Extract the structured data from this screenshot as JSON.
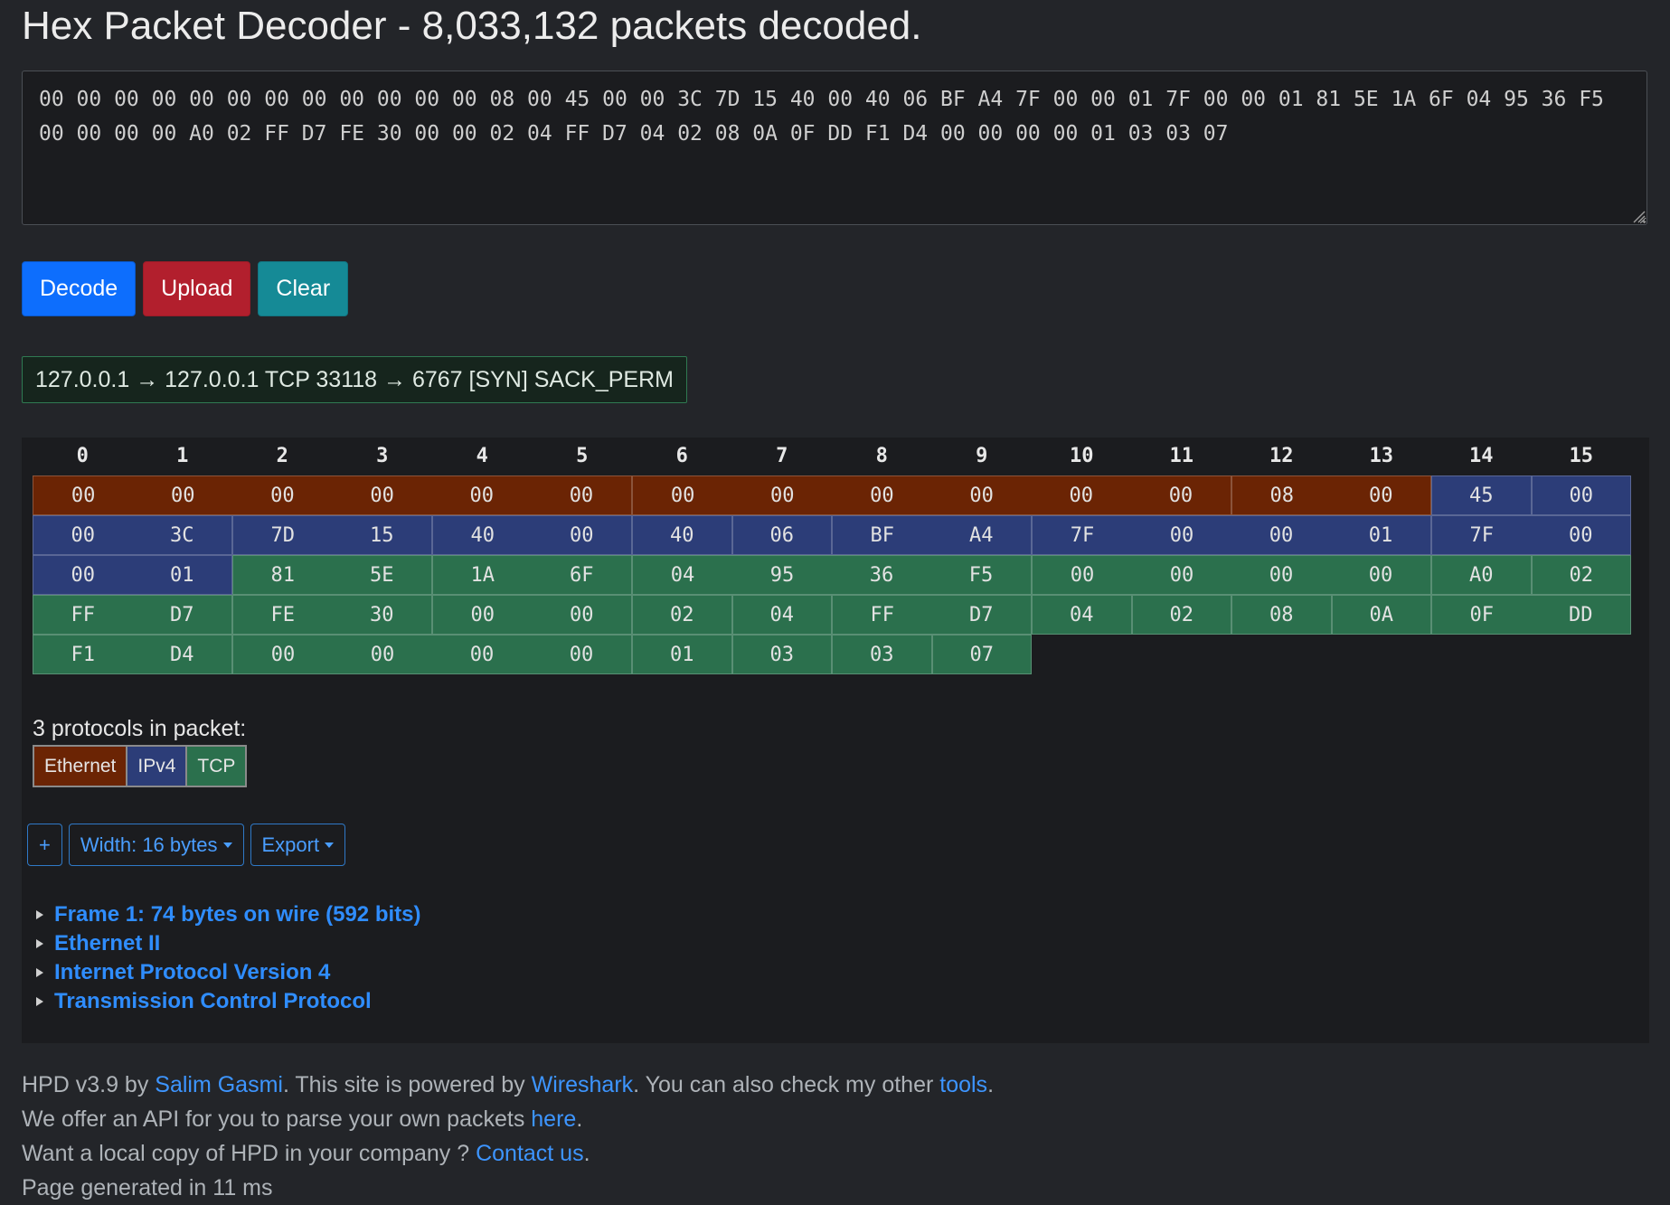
{
  "page": {
    "title": "Hex Packet Decoder - 8,033,132 packets decoded."
  },
  "input": {
    "hex": "00 00 00 00 00 00 00 00 00 00 00 00 08 00 45 00 00 3C 7D 15 40 00 40 06 BF A4 7F 00 00 01 7F 00 00 01 81 5E 1A 6F 04 95 36 F5 00 00 00 00 A0 02 FF D7 FE 30 00 00 02 04 FF D7 04 02 08 0A 0F DD F1 D4 00 00 00 00 01 03 03 07"
  },
  "buttons": {
    "decode": "Decode",
    "upload": "Upload",
    "clear": "Clear"
  },
  "summary": "127.0.0.1 → 127.0.0.1 TCP 33118 → 6767 [SYN] SACK_PERM",
  "hexview": {
    "columns": [
      "0",
      "1",
      "2",
      "3",
      "4",
      "5",
      "6",
      "7",
      "8",
      "9",
      "10",
      "11",
      "12",
      "13",
      "14",
      "15"
    ],
    "rows": [
      [
        {
          "group": [
            {
              "b": "00",
              "p": "eth"
            },
            {
              "b": "00",
              "p": "eth"
            },
            {
              "b": "00",
              "p": "eth"
            },
            {
              "b": "00",
              "p": "eth"
            },
            {
              "b": "00",
              "p": "eth"
            },
            {
              "b": "00",
              "p": "eth"
            }
          ]
        },
        {
          "group": [
            {
              "b": "00",
              "p": "eth"
            },
            {
              "b": "00",
              "p": "eth"
            },
            {
              "b": "00",
              "p": "eth"
            },
            {
              "b": "00",
              "p": "eth"
            },
            {
              "b": "00",
              "p": "eth"
            },
            {
              "b": "00",
              "p": "eth"
            }
          ]
        },
        {
          "group": [
            {
              "b": "08",
              "p": "eth"
            },
            {
              "b": "00",
              "p": "eth"
            }
          ]
        },
        {
          "group": [
            {
              "b": "45",
              "p": "ip"
            }
          ]
        },
        {
          "group": [
            {
              "b": "00",
              "p": "ip"
            }
          ]
        }
      ],
      [
        {
          "group": [
            {
              "b": "00",
              "p": "ip"
            },
            {
              "b": "3C",
              "p": "ip"
            }
          ]
        },
        {
          "group": [
            {
              "b": "7D",
              "p": "ip"
            },
            {
              "b": "15",
              "p": "ip"
            }
          ]
        },
        {
          "group": [
            {
              "b": "40",
              "p": "ip"
            },
            {
              "b": "00",
              "p": "ip"
            }
          ]
        },
        {
          "group": [
            {
              "b": "40",
              "p": "ip"
            }
          ]
        },
        {
          "group": [
            {
              "b": "06",
              "p": "ip"
            }
          ]
        },
        {
          "group": [
            {
              "b": "BF",
              "p": "ip"
            },
            {
              "b": "A4",
              "p": "ip"
            }
          ]
        },
        {
          "group": [
            {
              "b": "7F",
              "p": "ip"
            },
            {
              "b": "00",
              "p": "ip"
            },
            {
              "b": "00",
              "p": "ip"
            },
            {
              "b": "01",
              "p": "ip"
            }
          ]
        },
        {
          "group": [
            {
              "b": "7F",
              "p": "ip"
            },
            {
              "b": "00",
              "p": "ip"
            }
          ]
        }
      ],
      [
        {
          "group": [
            {
              "b": "00",
              "p": "ip"
            },
            {
              "b": "01",
              "p": "ip"
            }
          ]
        },
        {
          "group": [
            {
              "b": "81",
              "p": "tcp"
            },
            {
              "b": "5E",
              "p": "tcp"
            }
          ]
        },
        {
          "group": [
            {
              "b": "1A",
              "p": "tcp"
            },
            {
              "b": "6F",
              "p": "tcp"
            }
          ]
        },
        {
          "group": [
            {
              "b": "04",
              "p": "tcp"
            },
            {
              "b": "95",
              "p": "tcp"
            },
            {
              "b": "36",
              "p": "tcp"
            },
            {
              "b": "F5",
              "p": "tcp"
            }
          ]
        },
        {
          "group": [
            {
              "b": "00",
              "p": "tcp"
            },
            {
              "b": "00",
              "p": "tcp"
            },
            {
              "b": "00",
              "p": "tcp"
            },
            {
              "b": "00",
              "p": "tcp"
            }
          ]
        },
        {
          "group": [
            {
              "b": "A0",
              "p": "tcp"
            }
          ]
        },
        {
          "group": [
            {
              "b": "02",
              "p": "tcp"
            }
          ]
        }
      ],
      [
        {
          "group": [
            {
              "b": "FF",
              "p": "tcp"
            },
            {
              "b": "D7",
              "p": "tcp"
            }
          ]
        },
        {
          "group": [
            {
              "b": "FE",
              "p": "tcp"
            },
            {
              "b": "30",
              "p": "tcp"
            }
          ]
        },
        {
          "group": [
            {
              "b": "00",
              "p": "tcp"
            },
            {
              "b": "00",
              "p": "tcp"
            }
          ]
        },
        {
          "group": [
            {
              "b": "02",
              "p": "tcp"
            }
          ]
        },
        {
          "group": [
            {
              "b": "04",
              "p": "tcp"
            }
          ]
        },
        {
          "group": [
            {
              "b": "FF",
              "p": "tcp"
            },
            {
              "b": "D7",
              "p": "tcp"
            }
          ]
        },
        {
          "group": [
            {
              "b": "04",
              "p": "tcp"
            }
          ]
        },
        {
          "group": [
            {
              "b": "02",
              "p": "tcp"
            }
          ]
        },
        {
          "group": [
            {
              "b": "08",
              "p": "tcp"
            }
          ]
        },
        {
          "group": [
            {
              "b": "0A",
              "p": "tcp"
            }
          ]
        },
        {
          "group": [
            {
              "b": "0F",
              "p": "tcp"
            },
            {
              "b": "DD",
              "p": "tcp"
            }
          ]
        }
      ],
      [
        {
          "group": [
            {
              "b": "F1",
              "p": "tcp"
            },
            {
              "b": "D4",
              "p": "tcp"
            }
          ]
        },
        {
          "group": [
            {
              "b": "00",
              "p": "tcp"
            },
            {
              "b": "00",
              "p": "tcp"
            },
            {
              "b": "00",
              "p": "tcp"
            },
            {
              "b": "00",
              "p": "tcp"
            }
          ]
        },
        {
          "group": [
            {
              "b": "01",
              "p": "tcp"
            }
          ]
        },
        {
          "group": [
            {
              "b": "03",
              "p": "tcp"
            }
          ]
        },
        {
          "group": [
            {
              "b": "03",
              "p": "tcp"
            }
          ]
        },
        {
          "group": [
            {
              "b": "07",
              "p": "tcp"
            }
          ]
        }
      ]
    ]
  },
  "protocols": {
    "label": "3 protocols in packet:",
    "items": [
      "Ethernet",
      "IPv4",
      "TCP"
    ]
  },
  "toolbar": {
    "add": "+",
    "width": "Width: 16 bytes",
    "export": "Export"
  },
  "tree": [
    "Frame 1: 74 bytes on wire (592 bits)",
    "Ethernet II",
    "Internet Protocol Version 4",
    "Transmission Control Protocol"
  ],
  "footer": {
    "line1_a": "HPD v3.9 by ",
    "author": "Salim Gasmi",
    "line1_b": ". This site is powered by ",
    "wireshark": "Wireshark",
    "line1_c": ". You can also check my other ",
    "tools": "tools",
    "line1_d": ".",
    "line2_a": "We offer an API for you to parse your own packets ",
    "here": "here",
    "line2_b": ".",
    "line3_a": "Want a local copy of HPD in your company ? ",
    "contact": "Contact us",
    "line3_b": ".",
    "line4": "Page generated in 11 ms"
  }
}
